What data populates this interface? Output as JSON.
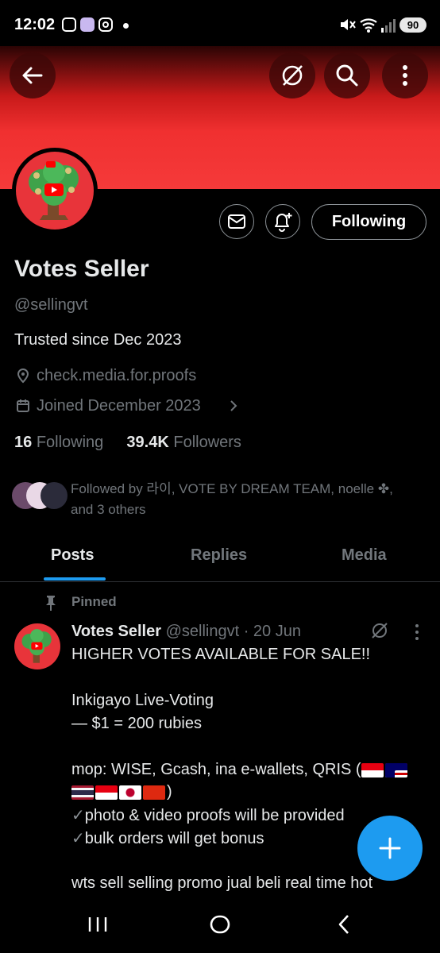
{
  "status_bar": {
    "time": "12:02",
    "battery": "90",
    "icons": [
      "screenshot-icon",
      "app-icon",
      "instagram-icon",
      "notification-dot",
      "mute-icon",
      "wifi-icon",
      "signal-icon"
    ]
  },
  "header": {
    "icons": [
      "back-arrow-icon",
      "grok-icon",
      "search-icon",
      "more-vertical-icon"
    ]
  },
  "profile": {
    "name": "Votes Seller",
    "handle": "@sellingvt",
    "bio": "Trusted since Dec 2023",
    "location": "check.media.for.proofs",
    "joined": "Joined December 2023",
    "following_count": "16",
    "following_label": "Following",
    "followers_count": "39.4K",
    "followers_label": "Followers",
    "follow_button": "Following",
    "followed_by_line1": "Followed by 라이, VOTE BY DREAM TEAM, noelle ✤,",
    "followed_by_line2": "and 3 others",
    "banner_color": "#f03030"
  },
  "tabs": [
    {
      "label": "Posts",
      "active": true
    },
    {
      "label": "Replies",
      "active": false
    },
    {
      "label": "Media",
      "active": false
    }
  ],
  "post": {
    "pinned_label": "Pinned",
    "author": "Votes Seller",
    "meta": "@sellingvt · 20 Jun",
    "lines": {
      "l1": "HIGHER VOTES AVAILABLE FOR SALE!!",
      "l2": "Inkigayo Live-Voting",
      "l3": "— $1 = 200 rubies",
      "l4": "mop: WISE, Gcash, ina e-wallets, QRIS (",
      "l5": ")",
      "l6": "photo & video proofs will be provided",
      "l7": "bulk orders will get bonus",
      "l8": "wts sell selling promo jual beli real time hot"
    },
    "flags": [
      "indonesia",
      "malaysia",
      "thailand",
      "indonesia",
      "japan",
      "china"
    ],
    "check_mark": "✓"
  },
  "fab": {
    "icon": "plus-icon"
  },
  "nav": {
    "icons": [
      "recent-apps-icon",
      "home-icon",
      "back-icon"
    ]
  },
  "colors": {
    "accent": "#1d9bf0",
    "background": "#000000",
    "muted": "#71767b"
  }
}
